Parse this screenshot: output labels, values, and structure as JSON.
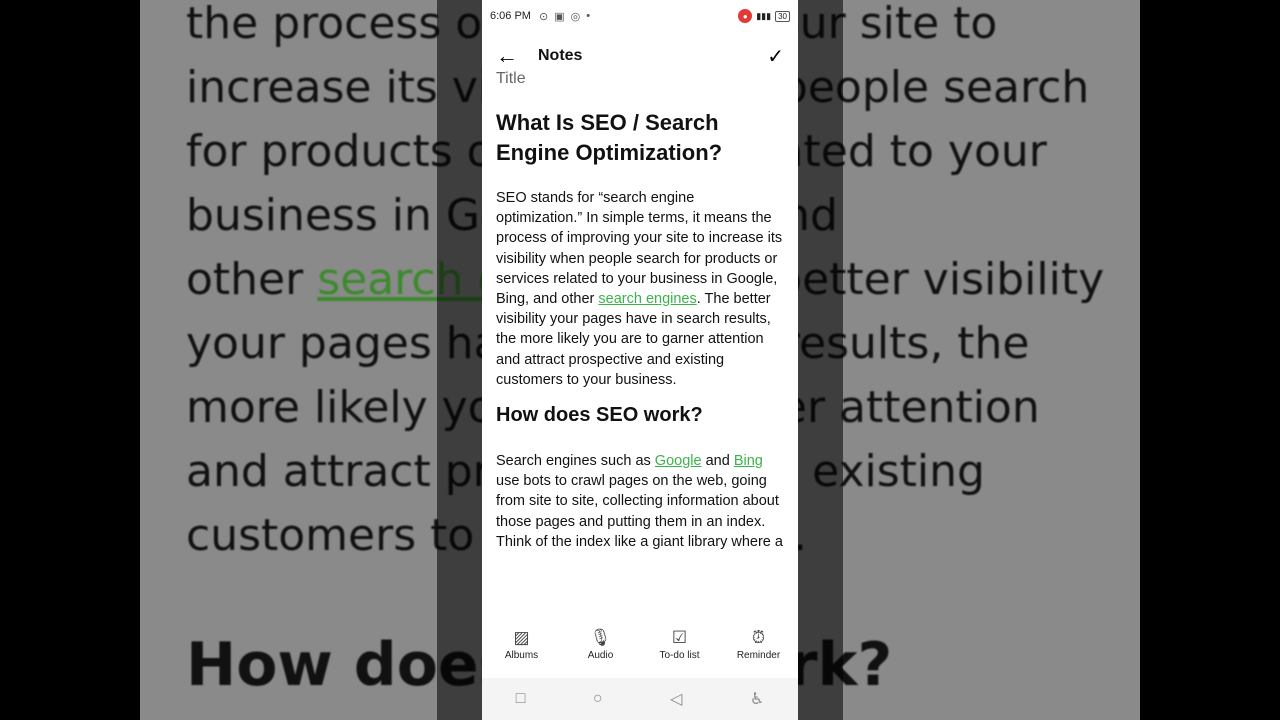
{
  "status": {
    "time": "6:06 PM",
    "battery": "30"
  },
  "app": {
    "title": "Notes"
  },
  "note": {
    "cut_title": "Title",
    "heading1": "What Is SEO / Search Engine Optimization?",
    "p1_a": "SEO stands for “search engine optimization.” In simple terms, it means the process of improving your site to increase its visibility when people search for products or services related to your business in Google, Bing, and other ",
    "p1_link": "search engines",
    "p1_b": ". The better visibility your pages have in search results, the more likely you are to garner attention and attract prospective and existing customers to your business.",
    "heading2": "How does SEO work?",
    "p2_a": "Search engines such as ",
    "p2_link1": "Google",
    "p2_mid": " and ",
    "p2_link2": "Bing",
    "p2_b": " use bots to crawl pages on the web, going from site to site, collecting information about those pages and putting them in an index. Think of the index like a giant library where a"
  },
  "toolbar": {
    "albums": "Albums",
    "audio": "Audio",
    "todo": "To-do list",
    "reminder": "Reminder"
  },
  "background": {
    "lines": [
      "the process of improving your site to",
      "increase its visibility when people search",
      "for products or services related to your",
      "business in Google, Bing, and",
      "other ",
      "your pages have in search results, the",
      "more likely you are to garner attention",
      "and attract prospective and existing",
      "customers to your business."
    ],
    "link": "search engines",
    "after_link": ". The better visibility",
    "heading": "How does SEO work?"
  },
  "colors": {
    "link": "#3bb34a",
    "record": "#e53935"
  }
}
